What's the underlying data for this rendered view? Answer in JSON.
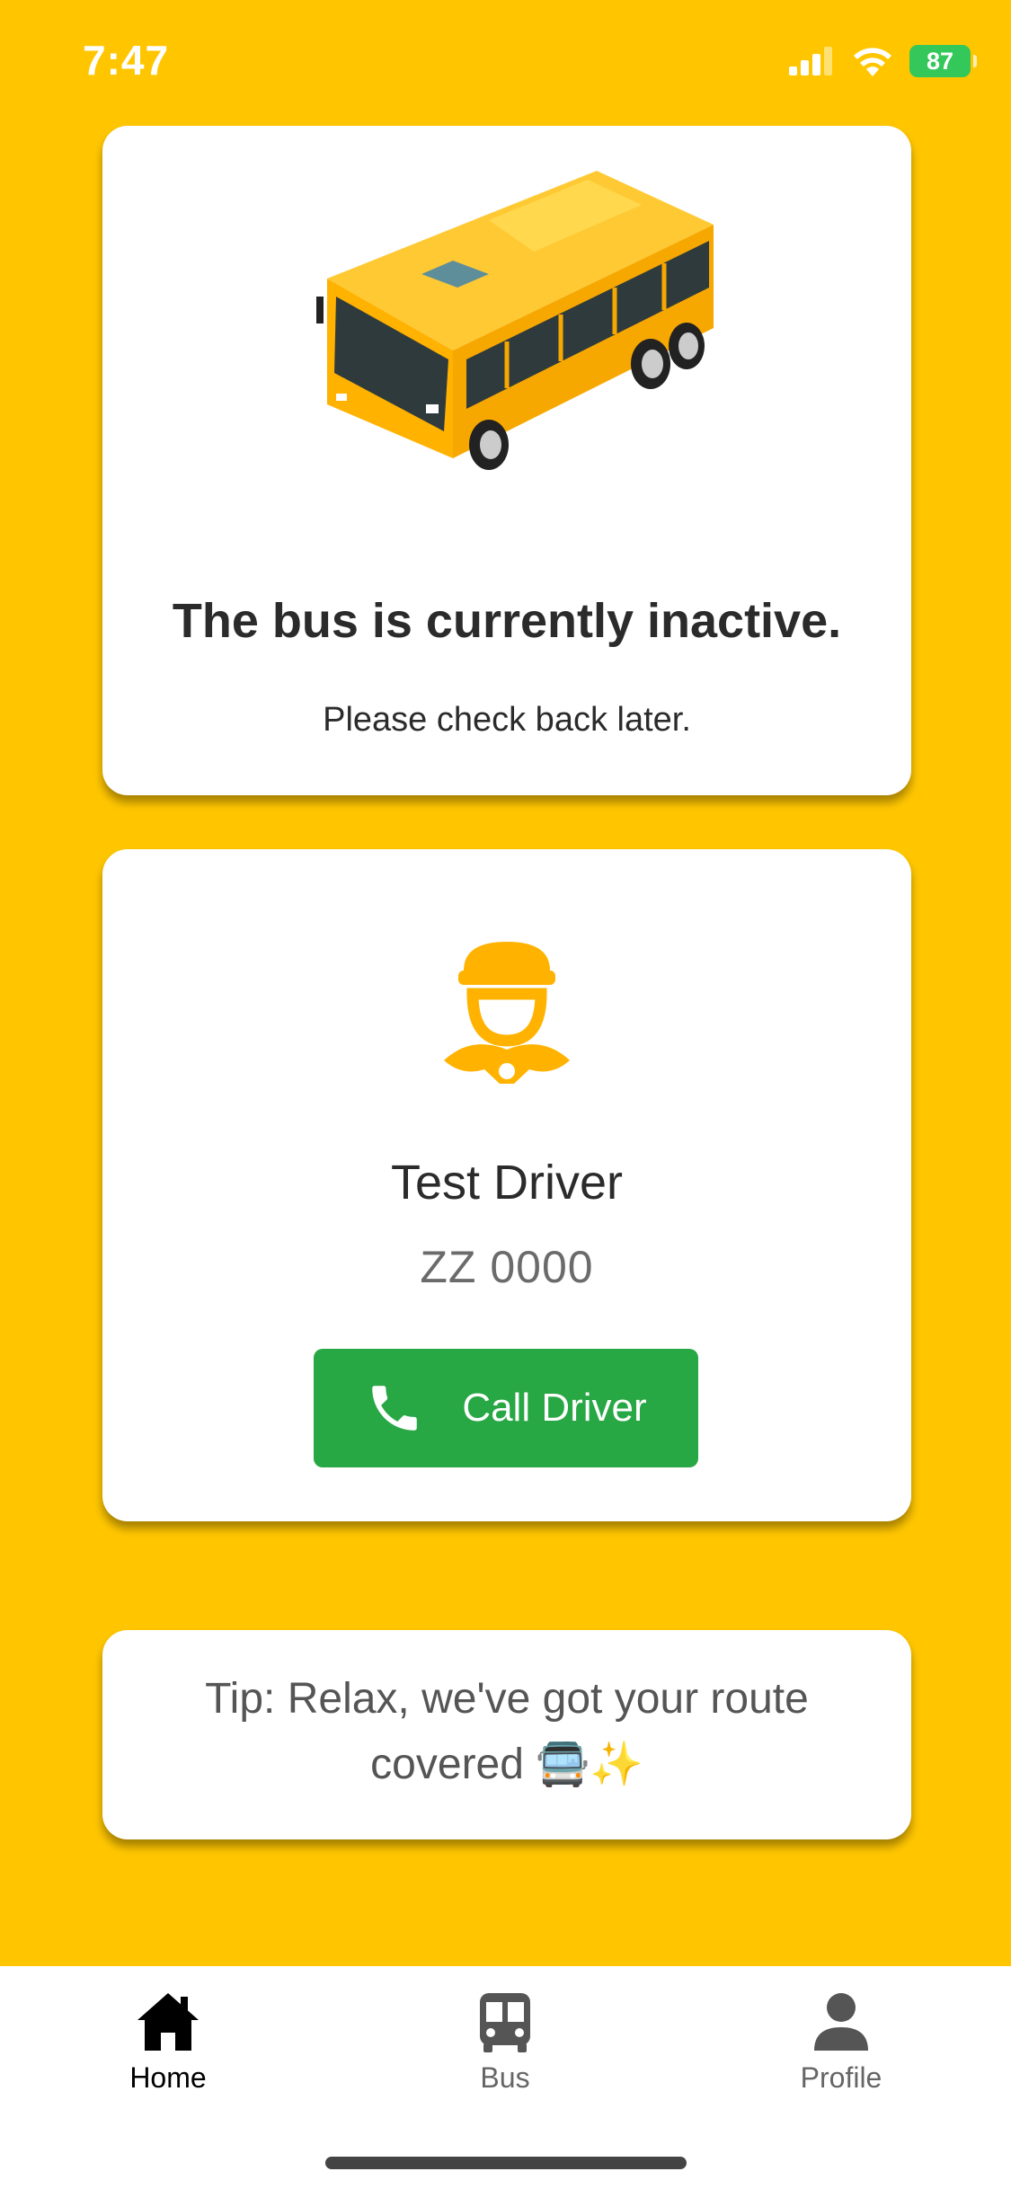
{
  "status_bar": {
    "time": "7:47",
    "battery": "87"
  },
  "bus_status": {
    "title": "The bus is currently inactive.",
    "subtitle": "Please check back later."
  },
  "driver": {
    "name": "Test Driver",
    "plate": "ZZ 0000",
    "call_label": "Call Driver"
  },
  "tip": {
    "text": "Tip: Relax, we've got your route covered 🚍✨"
  },
  "tabs": [
    {
      "label": "Home",
      "icon": "home-icon",
      "active": true
    },
    {
      "label": "Bus",
      "icon": "bus-icon",
      "active": false
    },
    {
      "label": "Profile",
      "icon": "person-icon",
      "active": false
    }
  ],
  "colors": {
    "background": "#FFC600",
    "call_button": "#28A745",
    "driver_icon": "#FFB300",
    "battery": "#34C759"
  }
}
